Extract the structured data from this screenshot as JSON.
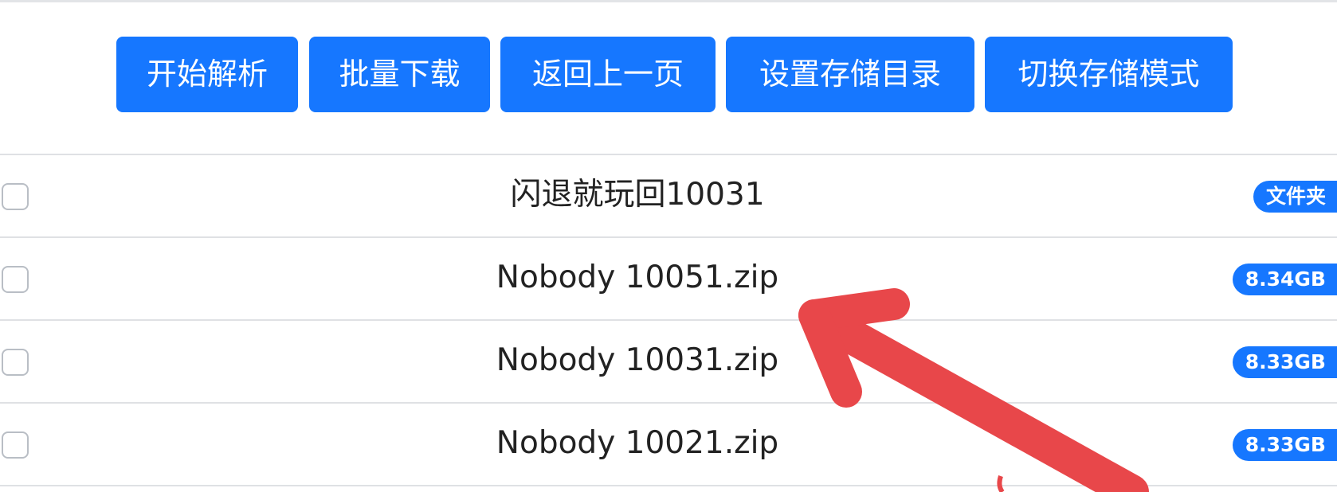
{
  "toolbar": {
    "buttons": [
      {
        "label": "开始解析"
      },
      {
        "label": "批量下载"
      },
      {
        "label": "返回上一页"
      },
      {
        "label": "设置存储目录"
      },
      {
        "label": "切换存储模式"
      }
    ],
    "button_color": "#1677ff"
  },
  "file_list": {
    "items": [
      {
        "name": "闪退就玩回10031",
        "badge": "文件夹"
      },
      {
        "name": "Nobody 10051.zip",
        "badge": "8.34GB"
      },
      {
        "name": "Nobody 10031.zip",
        "badge": "8.33GB"
      },
      {
        "name": "Nobody 10021.zip",
        "badge": "8.33GB"
      }
    ],
    "badge_color": "#1677ff"
  },
  "annotation": {
    "arrow_color": "#e8474a",
    "icon": "red-arrow-icon"
  }
}
